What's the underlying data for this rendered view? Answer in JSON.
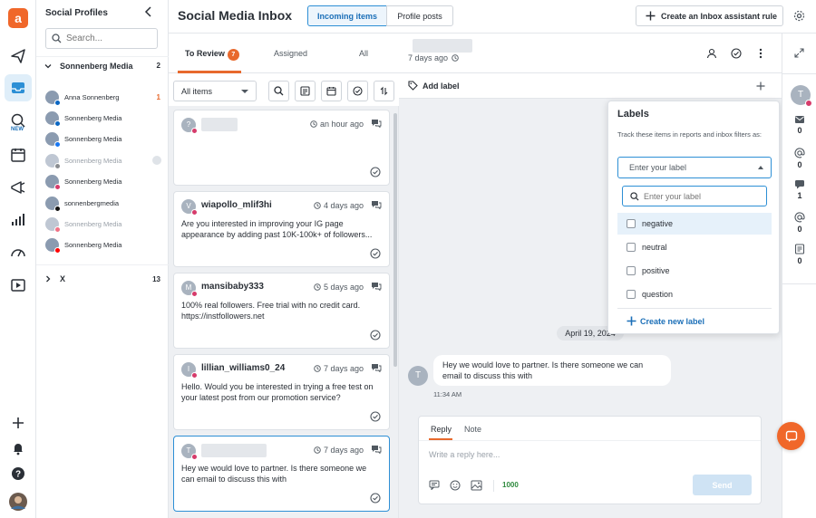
{
  "colors": {
    "accent": "#e8692d",
    "primary": "#2d8fd5",
    "link": "#1b6fb8",
    "instagram": "#d63b6b",
    "count_green": "#2e8a3e"
  },
  "rail": {
    "icons": [
      "app-logo-icon",
      "compose-icon",
      "inbox-icon",
      "listening-icon",
      "calendar-icon",
      "campaign-icon",
      "analytics-icon",
      "performance-icon",
      "media-library-icon",
      "add-icon",
      "notifications-icon",
      "help-icon",
      "user-avatar"
    ],
    "new_badge": "NEW"
  },
  "profiles": {
    "title": "Social Profiles",
    "search_placeholder": "Search...",
    "groups": [
      {
        "name": "Sonnenberg Media",
        "count": "2"
      },
      {
        "name": "X",
        "count": "13"
      }
    ],
    "items": [
      {
        "name": "Anna Sonnenberg",
        "network": "linkedin",
        "count": "1",
        "dim": false
      },
      {
        "name": "Sonnenberg Media",
        "network": "linkedin",
        "dim": false
      },
      {
        "name": "Sonnenberg Media",
        "network": "facebook",
        "dim": false
      },
      {
        "name": "Sonnenberg Media",
        "network": "x",
        "dim": true
      },
      {
        "name": "Sonnenberg Media",
        "network": "instagram",
        "dim": false
      },
      {
        "name": "sonnenbergmedia",
        "network": "tiktok",
        "dim": false
      },
      {
        "name": "Sonnenberg Media",
        "network": "pinterest",
        "dim": true
      },
      {
        "name": "Sonnenberg Media",
        "network": "youtube",
        "dim": false
      }
    ]
  },
  "header": {
    "title": "Social Media Inbox",
    "tabs": [
      {
        "label": "Incoming items",
        "active": true
      },
      {
        "label": "Profile posts",
        "active": false
      }
    ],
    "assistant_button": "Create an Inbox assistant rule"
  },
  "list": {
    "tabs": [
      {
        "label": "To Review",
        "badge": "7"
      },
      {
        "label": "Assigned"
      },
      {
        "label": "All"
      }
    ],
    "filter_value": "All items",
    "messages": [
      {
        "username": "",
        "avatar": "?",
        "time": "an hour ago",
        "body": "",
        "blurred": true
      },
      {
        "username": "wiapollo_mlif3hi",
        "avatar": "V",
        "time": "4 days ago",
        "body": "Are you interested in improving your IG page appearance by adding past 10K-100k+ of followers...",
        "blurred": false
      },
      {
        "username": "mansibaby333",
        "avatar": "M",
        "time": "5 days ago",
        "body": "100% real followers.  Free trial with no credit card. https://instfollowers.net",
        "blurred": false
      },
      {
        "username": "lillian_williams0_24",
        "avatar": "I",
        "time": "7 days ago",
        "body": "Hello. Would you be interested in trying a free test on your latest post from our promotion service?",
        "blurred": false
      },
      {
        "username": "",
        "avatar": "T",
        "time": "7 days ago",
        "body": "Hey we would love to partner. Is there someone we can email to discuss this with",
        "blurred": true,
        "selected": true
      }
    ]
  },
  "conversation": {
    "header_time": "7 days ago",
    "add_label": "Add label",
    "date_divider": "April 19, 2024",
    "message_avatar": "T",
    "message": "Hey we would love to partner. Is there someone we can email to discuss this with",
    "message_time": "11:34 AM",
    "reply_tabs": [
      "Reply",
      "Note"
    ],
    "reply_placeholder": "Write a reply here...",
    "char_count": "1000",
    "send_label": "Send"
  },
  "labels_panel": {
    "title": "Labels",
    "description": "Track these items in reports and inbox filters as:",
    "select_placeholder": "Enter your label",
    "search_placeholder": "Enter your label",
    "options": [
      "negative",
      "neutral",
      "positive",
      "question"
    ],
    "create_label": "Create new label"
  },
  "stats": {
    "avatar": "T",
    "items": [
      {
        "icon": "message-icon",
        "value": "0"
      },
      {
        "icon": "mention-icon",
        "value": "0"
      },
      {
        "icon": "comment-icon",
        "value": "1"
      },
      {
        "icon": "at-mention-icon",
        "value": "0"
      },
      {
        "icon": "review-icon",
        "value": "0"
      }
    ]
  }
}
